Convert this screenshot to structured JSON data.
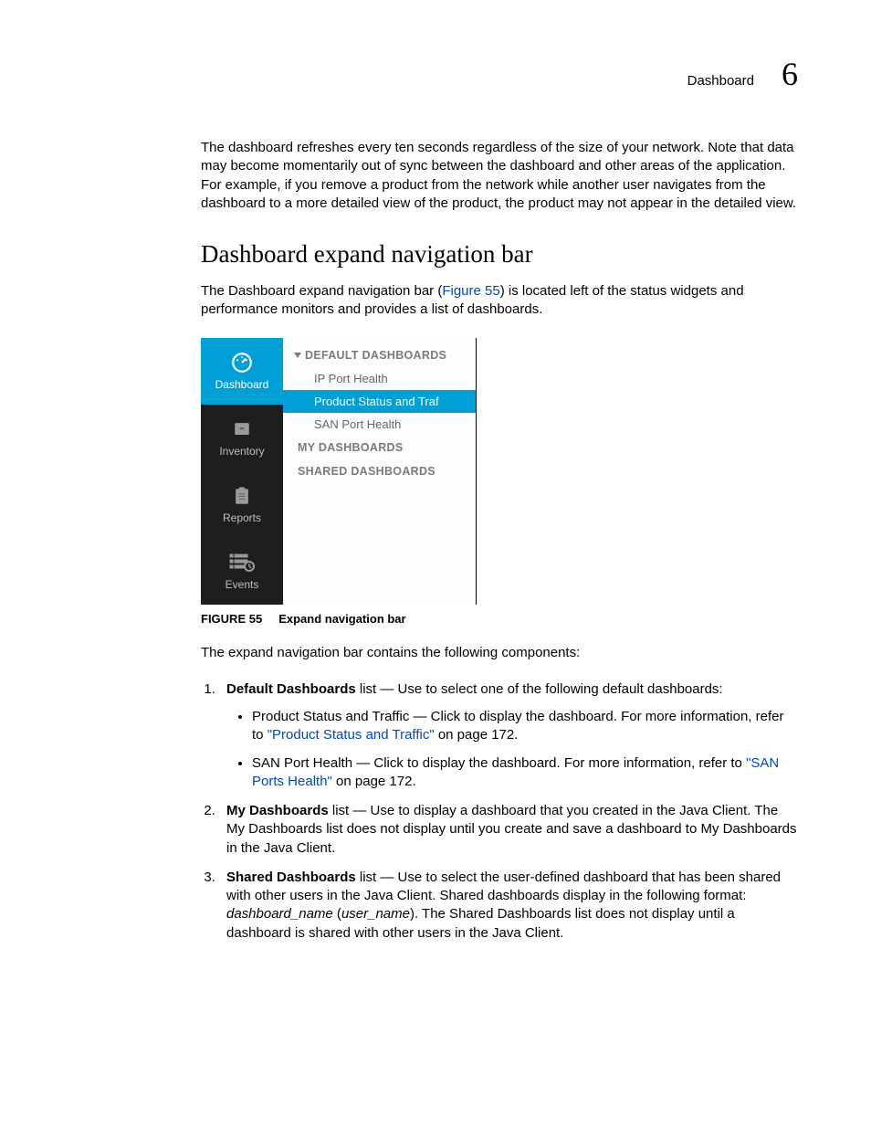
{
  "header": {
    "label": "Dashboard",
    "chapter": "6"
  },
  "intro": "The dashboard refreshes every ten seconds regardless of the size of your network. Note that data may become momentarily out of sync between the dashboard and other areas of the application. For example, if you remove a product from the network while another user navigates from the dashboard to a more detailed view of the product, the product may not appear in the detailed view.",
  "section_title": "Dashboard expand navigation bar",
  "section_lead_1": "The Dashboard expand navigation bar (",
  "section_lead_link": "Figure 55",
  "section_lead_2": ") is located left of the status widgets and performance monitors and provides a list of dashboards.",
  "nav": {
    "items": [
      {
        "label": "Dashboard"
      },
      {
        "label": "Inventory"
      },
      {
        "label": "Reports"
      },
      {
        "label": "Events"
      }
    ]
  },
  "expand": {
    "group1": "DEFAULT DASHBOARDS",
    "items1": [
      "IP Port Health",
      "Product Status and Traf",
      "SAN Port Health"
    ],
    "group2": "MY DASHBOARDS",
    "group3": "SHARED DASHBOARDS"
  },
  "figure": {
    "num": "FIGURE 55",
    "caption": "Expand navigation bar"
  },
  "after_fig": "The expand navigation bar contains the following components:",
  "list": {
    "i1_bold": "Default Dashboards",
    "i1_rest": " list — Use to select one of the following default dashboards:",
    "b1_pre": "Product Status and Traffic — Click to display the dashboard. For more information, refer to ",
    "b1_link": "\"Product Status and Traffic\"",
    "b1_post": " on page 172.",
    "b2_pre": "SAN Port Health — Click to display the dashboard. For more information, refer to ",
    "b2_link": "\"SAN Ports Health\"",
    "b2_post": " on page 172.",
    "i2_bold": "My Dashboards",
    "i2_rest": " list — Use to display a dashboard that you created in the Java Client. The My Dashboards list does not display until you create and save a dashboard to My Dashboards in the Java Client.",
    "i3_bold": "Shared Dashboards",
    "i3_rest_a": " list — Use to select the user-defined dashboard that has been shared with other users in the Java Client. Shared dashboards display in the following format: ",
    "i3_italic": "dashboard_name",
    "i3_paren_open": " (",
    "i3_italic2": "user_name",
    "i3_rest_b": "). The Shared Dashboards list does not display until a dashboard is shared with other users in the Java Client."
  }
}
